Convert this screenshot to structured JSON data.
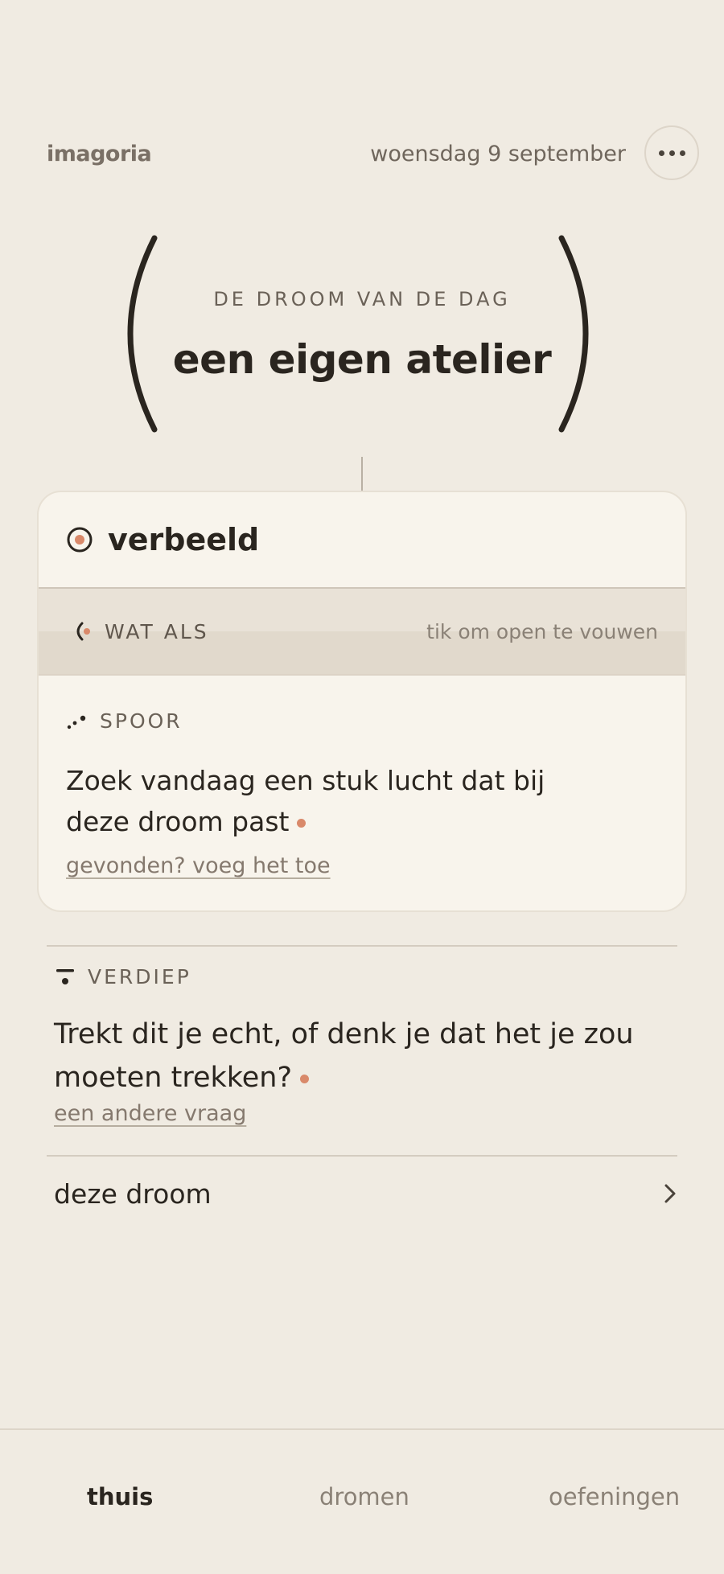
{
  "header": {
    "brand": "imagoria",
    "date": "woensdag 9 september",
    "more_icon": "more-horizontal-icon"
  },
  "hero": {
    "eyebrow": "DE DROOM VAN DE DAG",
    "title": "een eigen atelier"
  },
  "card": {
    "title": "verbeeld",
    "title_icon": "target-icon",
    "what_if": {
      "label": "WAT ALS",
      "hint": "tik om open te vouwen",
      "icon": "crescent-icon"
    },
    "trace": {
      "label": "SPOOR",
      "icon": "dots-trail-icon",
      "text": "Zoek vandaag een stuk lucht dat bij deze droom past",
      "link": "gevonden? voeg het toe"
    }
  },
  "deepen": {
    "label": "VERDIEP",
    "icon": "deepen-icon",
    "text": "Trekt dit je echt, of denk je dat het je zou moeten trekken?",
    "link": "een andere vraag"
  },
  "dream_row": {
    "label": "deze droom",
    "icon": "chevron-right-icon"
  },
  "nav": {
    "items": [
      {
        "label": "thuis",
        "active": true
      },
      {
        "label": "dromen",
        "active": false
      },
      {
        "label": "oefeningen",
        "active": false
      }
    ]
  },
  "colors": {
    "background": "#f0ebe2",
    "card": "#f8f4ec",
    "accent": "#d9896a",
    "ink": "#2a251f"
  }
}
